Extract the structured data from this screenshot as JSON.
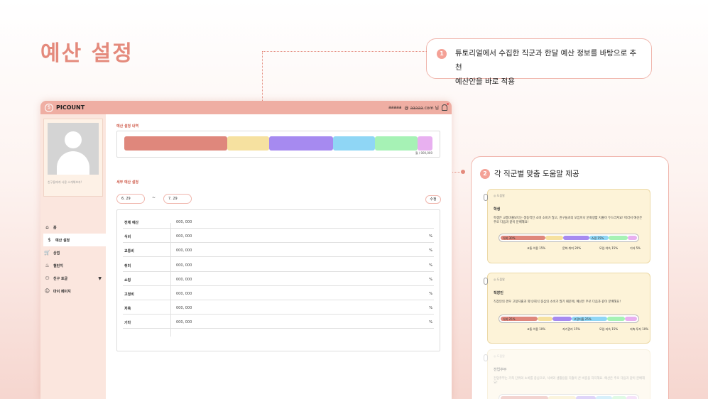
{
  "page_title": "예산 설정",
  "callout1": {
    "num": "1",
    "line1": "튜토리얼에서 수집한 직군과 한달 예산 정보를 바탕으로 추천",
    "line2": "예산안을 바로 적용"
  },
  "callout2": {
    "num": "2",
    "title": "각 직군별 맞춤 도움말 제공"
  },
  "app": {
    "logo_icon": "$",
    "logo": "PICOUNT",
    "user": "aaaaa",
    "email": "@ aaaaa.com 님",
    "profile_hint": "친구들에게 사용 소개해보자!",
    "nav": [
      {
        "label": "홈",
        "icon": "home-icon",
        "glyph": "⌂"
      },
      {
        "label": "예산 설정",
        "icon": "coin-icon",
        "glyph": "$",
        "active": true
      },
      {
        "label": "상점",
        "icon": "cart-icon",
        "glyph": "🛒"
      },
      {
        "label": "챌린지",
        "icon": "fire-icon",
        "glyph": "♨"
      },
      {
        "label": "친구 토글",
        "icon": "friends-icon",
        "glyph": "⚇",
        "caret": "▼"
      },
      {
        "label": "마이 페이지",
        "icon": "user-icon",
        "glyph": "☺"
      }
    ],
    "budget_section_label": "예산 설정 내역",
    "budget_bar_caption": "월 / 000,000",
    "budget_segments": [
      {
        "name": "식비",
        "color": "#df877c",
        "share": 0.34
      },
      {
        "name": "교통비",
        "color": "#f6e1a0",
        "share": 0.14
      },
      {
        "name": "취미",
        "color": "#a68af0",
        "share": 0.21
      },
      {
        "name": "쇼핑",
        "color": "#8fd6f5",
        "share": 0.14
      },
      {
        "name": "저축",
        "color": "#a6f2b5",
        "share": 0.14
      },
      {
        "name": "기타",
        "color": "#e8b0f0",
        "share": 0.05
      }
    ],
    "detail_section_label": "세부 예산 설정",
    "date_from": "6. 29",
    "date_sep": "~",
    "date_to": "7. 29",
    "edit_label": "수정",
    "table": [
      {
        "k": "전체 예산",
        "v": "000, 000",
        "p": ""
      },
      {
        "k": "식비",
        "v": "000, 000",
        "p": "%"
      },
      {
        "k": "교통비",
        "v": "000, 000",
        "p": "%"
      },
      {
        "k": "취미",
        "v": "000, 000",
        "p": "%"
      },
      {
        "k": "쇼핑",
        "v": "000, 000",
        "p": "%"
      },
      {
        "k": "고정비",
        "v": "000, 000",
        "p": "%"
      },
      {
        "k": "저축",
        "v": "000, 000",
        "p": "%"
      },
      {
        "k": "기타",
        "v": "000, 000",
        "p": "%"
      }
    ]
  },
  "guides": [
    {
      "tag": "◎ 도움말",
      "role": "학생",
      "desc": "학생은 교통비출보다는 생동적인 소비 소비가 많고, 친구들과의 모임이나 문화생활 지출이 두드러져요! 따라서 예산은 주로 다음과 같이 분배해요!",
      "bar": [
        {
          "label": "식비 30%",
          "color": "#df877c",
          "share": 0.33
        },
        {
          "label": "",
          "color": "#f6e1a0",
          "share": 0.13
        },
        {
          "label": "",
          "color": "#a68af0",
          "share": 0.19
        },
        {
          "label": "쇼핑 15%",
          "color": "#8fd6f5",
          "share": 0.14
        },
        {
          "label": "",
          "color": "#a6f2b5",
          "share": 0.14
        },
        {
          "label": "",
          "color": "#e8b0f0",
          "share": 0.07
        }
      ],
      "labels": [
        "교통·이용 15%",
        "문화·취미 20%",
        "모임·약속 15%",
        "기타 5%"
      ]
    },
    {
      "tag": "◎ 도움말",
      "role": "직장인",
      "desc": "직장인의 경우 고정지출과 외식/회식 중심의 소비가 많기 때문에, 예산은 주로 다음과 같이 분배해요!",
      "bar": [
        {
          "label": "식비 25%",
          "color": "#df877c",
          "share": 0.27
        },
        {
          "label": "",
          "color": "#f6e1a0",
          "share": 0.11
        },
        {
          "label": "",
          "color": "#a68af0",
          "share": 0.14
        },
        {
          "label": "고정지출 25%",
          "color": "#8fd6f5",
          "share": 0.26
        },
        {
          "label": "",
          "color": "#a6f2b5",
          "share": 0.13
        },
        {
          "label": "",
          "color": "#e8b0f0",
          "share": 0.09
        }
      ],
      "labels": [
        "교통·이용 10%",
        "자기관리 15%",
        "모임·지속 15%",
        "저축·투자 10%"
      ]
    },
    {
      "tag": "◎ 도움말",
      "role": "전업주부",
      "desc": "전업주부는 가족 단위의 소비를 중심으로, 식비와 생활용품 지출이 큰 비중을 차지해요. 예산은 주로 다음과 같이 분배해요!",
      "bar": [
        {
          "label": "",
          "color": "#df877c",
          "share": 0.35
        },
        {
          "label": "",
          "color": "#f6e1a0",
          "share": 0.2
        },
        {
          "label": "",
          "color": "#a68af0",
          "share": 0.15
        },
        {
          "label": "",
          "color": "#8fd6f5",
          "share": 0.12
        },
        {
          "label": "",
          "color": "#a6f2b5",
          "share": 0.1
        },
        {
          "label": "",
          "color": "#e8b0f0",
          "share": 0.08
        }
      ],
      "labels": []
    }
  ]
}
